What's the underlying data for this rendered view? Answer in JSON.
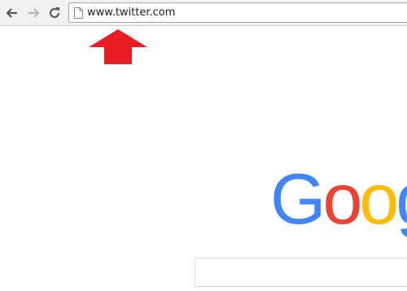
{
  "browser": {
    "address_bar": {
      "url": "www.twitter.com"
    },
    "nav": {
      "back_icon": "arrow-left-icon",
      "forward_icon": "arrow-right-icon",
      "reload_icon": "reload-icon",
      "page_icon": "page-icon"
    }
  },
  "annotation": {
    "arrow_icon": "red-up-arrow",
    "arrow_color": "#ec1c24"
  },
  "logo": {
    "letters": [
      "G",
      "o",
      "o",
      "g"
    ],
    "colors": [
      "#4285f4",
      "#ea4335",
      "#fbbc05",
      "#4285f4"
    ]
  },
  "search": {
    "value": ""
  }
}
